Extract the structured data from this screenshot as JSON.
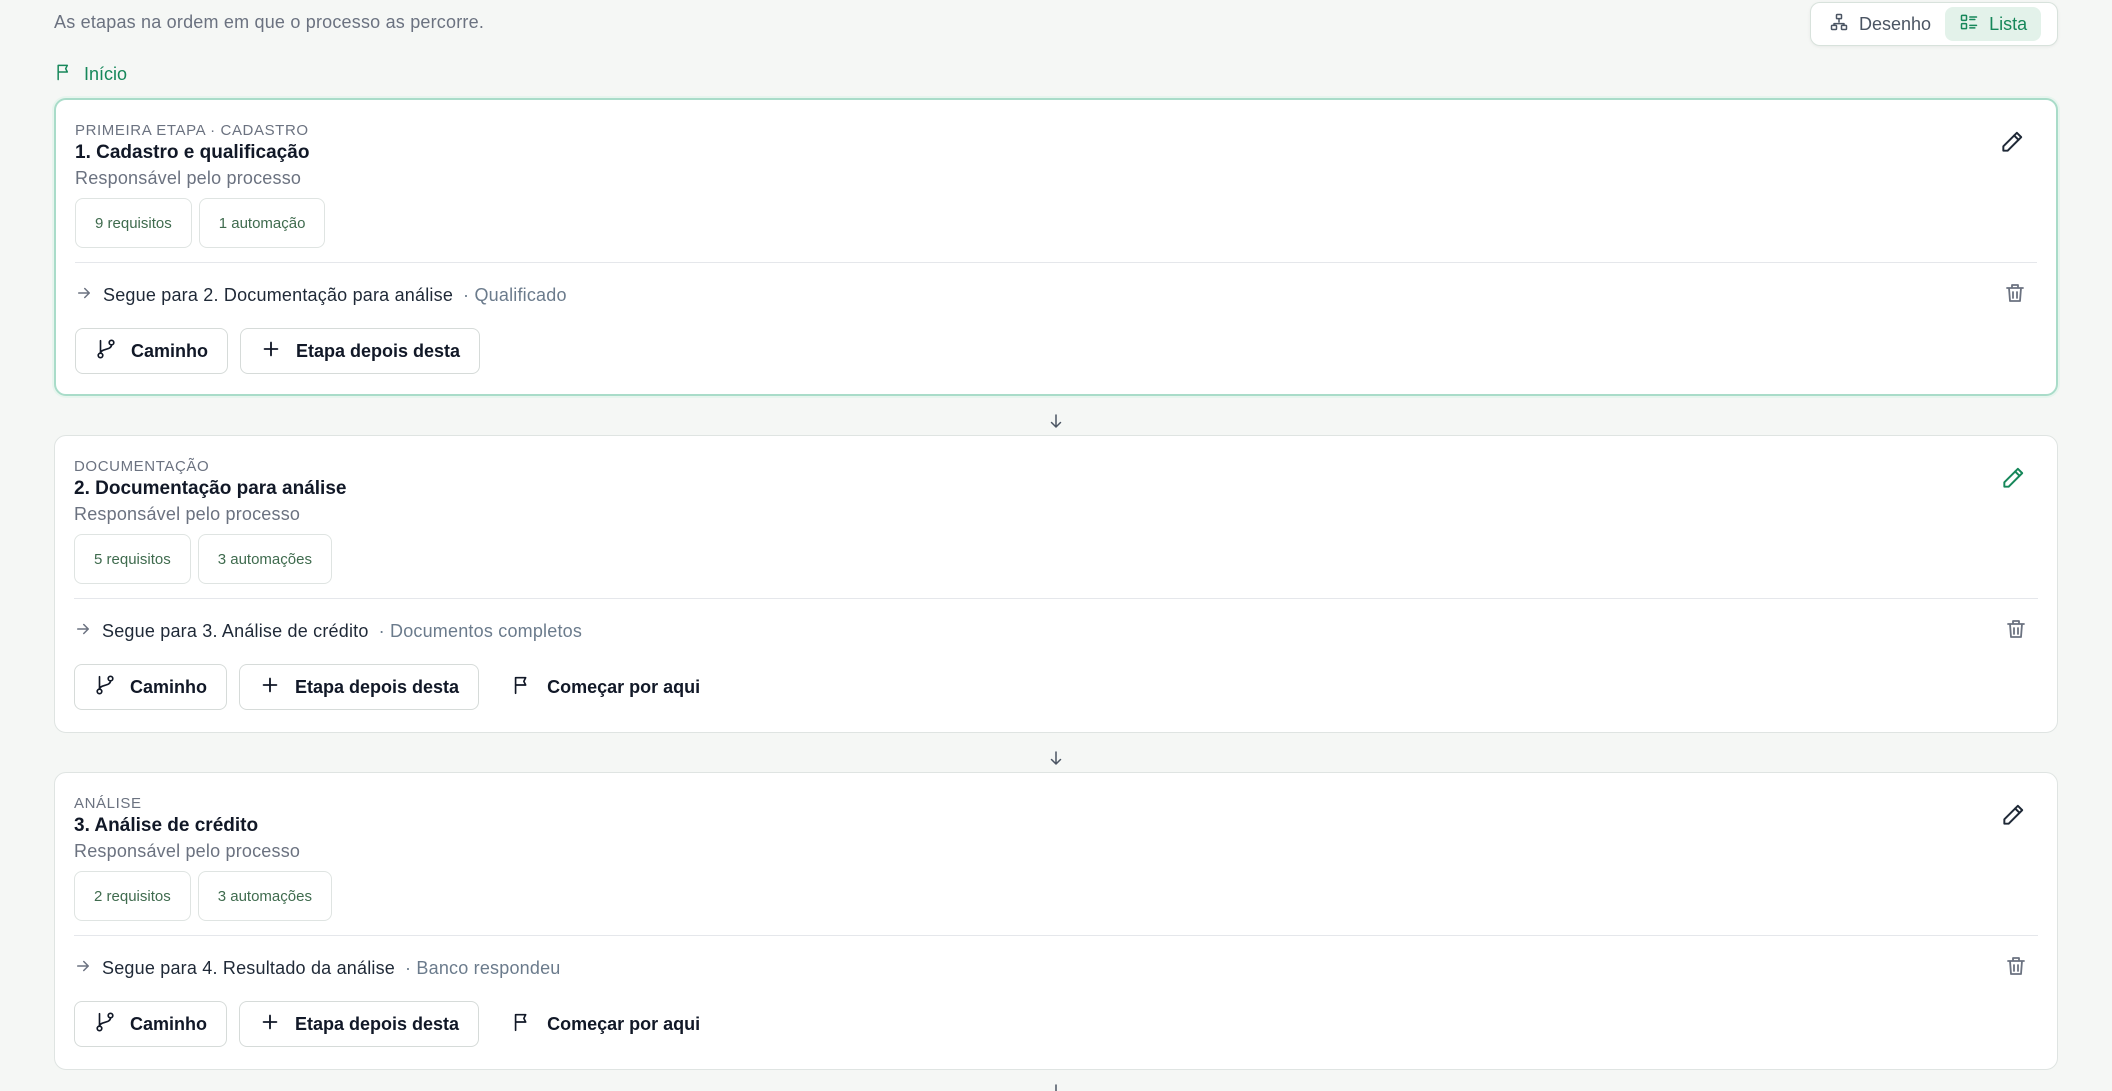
{
  "header": {
    "subtitle": "As etapas na ordem em que o processo as percorre.",
    "view_toggle": [
      {
        "label": "Desenho",
        "icon": "workflow-icon",
        "active": false
      },
      {
        "label": "Lista",
        "icon": "list-icon",
        "active": true
      }
    ]
  },
  "start": {
    "label": "Início",
    "icon": "flag-icon"
  },
  "colors": {
    "accent": "#16875a",
    "accent_bg": "#e3f2ea",
    "selected_border": "#a9dcc9",
    "chip_text": "#3f6b4e",
    "muted": "#6b7280"
  },
  "common": {
    "owner": "Responsável pelo processo",
    "route_prefix": "Segue para",
    "path_button": "Caminho",
    "add_after_button": "Etapa depois desta",
    "start_here_button": "Começar por aqui"
  },
  "stages": [
    {
      "eyebrow": "PRIMEIRA ETAPA · CADASTRO",
      "title": "1. Cadastro e qualificação",
      "owner": "Responsável pelo processo",
      "chips": [
        "9 requisitos",
        "1 automação"
      ],
      "route_target": "2. Documentação para análise",
      "route_condition": "· Qualificado",
      "selected": true,
      "edit_icon_color": "#1f2937",
      "show_start_here": false
    },
    {
      "eyebrow": "DOCUMENTAÇÃO",
      "title": "2. Documentação para análise",
      "owner": "Responsável pelo processo",
      "chips": [
        "5 requisitos",
        "3 automações"
      ],
      "route_target": "3. Análise de crédito",
      "route_condition": "· Documentos completos",
      "selected": false,
      "edit_icon_color": "#16875a",
      "show_start_here": true
    },
    {
      "eyebrow": "ANÁLISE",
      "title": "3. Análise de crédito",
      "owner": "Responsável pelo processo",
      "chips": [
        "2 requisitos",
        "3 automações"
      ],
      "route_target": "4. Resultado da análise",
      "route_condition": "· Banco respondeu",
      "selected": false,
      "edit_icon_color": "#1f2937",
      "show_start_here": true
    }
  ]
}
